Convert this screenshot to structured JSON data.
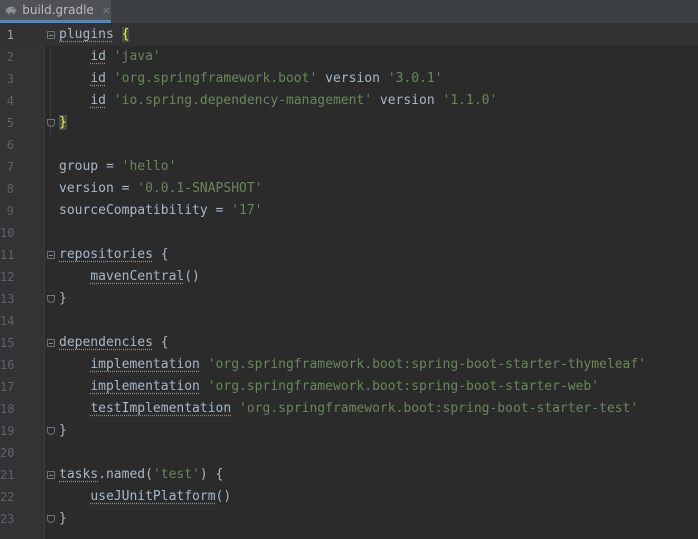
{
  "tab": {
    "filename": "build.gradle",
    "close_glyph": "×"
  },
  "lines": [
    {
      "n": "1",
      "tokens": [
        {
          "t": "plugins",
          "c": "kw"
        },
        {
          "t": " ",
          "c": "plain"
        },
        {
          "t": "{",
          "c": "brace-hl"
        }
      ]
    },
    {
      "n": "2",
      "tokens": [
        {
          "t": "    ",
          "c": "plain"
        },
        {
          "t": "id",
          "c": "kw"
        },
        {
          "t": " ",
          "c": "plain"
        },
        {
          "t": "'java'",
          "c": "str"
        }
      ]
    },
    {
      "n": "3",
      "tokens": [
        {
          "t": "    ",
          "c": "plain"
        },
        {
          "t": "id",
          "c": "kw"
        },
        {
          "t": " ",
          "c": "plain"
        },
        {
          "t": "'org.springframework.boot'",
          "c": "str"
        },
        {
          "t": " version ",
          "c": "plain"
        },
        {
          "t": "'3.0.1'",
          "c": "str"
        }
      ]
    },
    {
      "n": "4",
      "tokens": [
        {
          "t": "    ",
          "c": "plain"
        },
        {
          "t": "id",
          "c": "kw"
        },
        {
          "t": " ",
          "c": "plain"
        },
        {
          "t": "'io.spring.dependency-management'",
          "c": "str"
        },
        {
          "t": " version ",
          "c": "plain"
        },
        {
          "t": "'1.1.0'",
          "c": "str"
        }
      ]
    },
    {
      "n": "5",
      "tokens": [
        {
          "t": "}",
          "c": "brace-hl"
        }
      ]
    },
    {
      "n": "6",
      "tokens": []
    },
    {
      "n": "7",
      "tokens": [
        {
          "t": "group = ",
          "c": "plain"
        },
        {
          "t": "'hello'",
          "c": "str"
        }
      ]
    },
    {
      "n": "8",
      "tokens": [
        {
          "t": "version = ",
          "c": "plain"
        },
        {
          "t": "'0.0.1-SNAPSHOT'",
          "c": "str"
        }
      ]
    },
    {
      "n": "9",
      "tokens": [
        {
          "t": "sourceCompatibility = ",
          "c": "plain"
        },
        {
          "t": "'17'",
          "c": "str"
        }
      ]
    },
    {
      "n": "10",
      "tokens": []
    },
    {
      "n": "11",
      "tokens": [
        {
          "t": "repositories",
          "c": "kw"
        },
        {
          "t": " {",
          "c": "plain"
        }
      ]
    },
    {
      "n": "12",
      "tokens": [
        {
          "t": "    ",
          "c": "plain"
        },
        {
          "t": "mavenCentral",
          "c": "kw"
        },
        {
          "t": "()",
          "c": "plain"
        }
      ]
    },
    {
      "n": "13",
      "tokens": [
        {
          "t": "}",
          "c": "plain"
        }
      ]
    },
    {
      "n": "14",
      "tokens": []
    },
    {
      "n": "15",
      "tokens": [
        {
          "t": "dependencies",
          "c": "kw"
        },
        {
          "t": " {",
          "c": "plain"
        }
      ]
    },
    {
      "n": "16",
      "tokens": [
        {
          "t": "    ",
          "c": "plain"
        },
        {
          "t": "implementation",
          "c": "kw"
        },
        {
          "t": " ",
          "c": "plain"
        },
        {
          "t": "'org.springframework.boot:spring-boot-starter-thymeleaf'",
          "c": "str"
        }
      ]
    },
    {
      "n": "17",
      "tokens": [
        {
          "t": "    ",
          "c": "plain"
        },
        {
          "t": "implementation",
          "c": "kw"
        },
        {
          "t": " ",
          "c": "plain"
        },
        {
          "t": "'org.springframework.boot:spring-boot-starter-web'",
          "c": "str"
        }
      ]
    },
    {
      "n": "18",
      "tokens": [
        {
          "t": "    ",
          "c": "plain"
        },
        {
          "t": "testImplementation",
          "c": "kw"
        },
        {
          "t": " ",
          "c": "plain"
        },
        {
          "t": "'org.springframework.boot:spring-boot-starter-test'",
          "c": "str"
        }
      ]
    },
    {
      "n": "19",
      "tokens": [
        {
          "t": "}",
          "c": "plain"
        }
      ]
    },
    {
      "n": "20",
      "tokens": []
    },
    {
      "n": "21",
      "tokens": [
        {
          "t": "tasks",
          "c": "kw"
        },
        {
          "t": ".named(",
          "c": "plain"
        },
        {
          "t": "'test'",
          "c": "str"
        },
        {
          "t": ") {",
          "c": "plain"
        }
      ]
    },
    {
      "n": "22",
      "tokens": [
        {
          "t": "    ",
          "c": "plain"
        },
        {
          "t": "useJUnitPlatform",
          "c": "kw"
        },
        {
          "t": "()",
          "c": "plain"
        }
      ]
    },
    {
      "n": "23",
      "tokens": [
        {
          "t": "}",
          "c": "plain"
        }
      ]
    }
  ],
  "fold_markers": {
    "open_lines": [
      "1",
      "11",
      "15",
      "21"
    ],
    "close_lines": [
      "5",
      "13",
      "19",
      "23"
    ]
  },
  "current_line": "1",
  "colors": {
    "background": "#2b2b2b",
    "gutter": "#313335",
    "string": "#6a8759",
    "text": "#a9b7c6",
    "brace_match": "#ffef28"
  }
}
